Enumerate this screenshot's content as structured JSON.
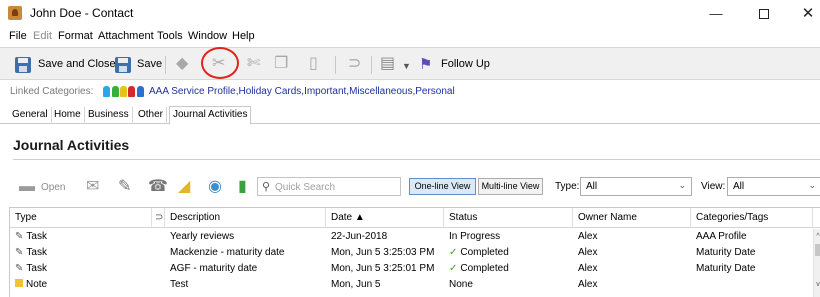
{
  "window": {
    "title": "John Doe - Contact",
    "minimize_glyph": "—",
    "close_glyph": "✕"
  },
  "menu": [
    "File",
    "Edit",
    "Format",
    "Attachment",
    "Tools",
    "Window",
    "Help"
  ],
  "menu_disabled": [
    "Edit"
  ],
  "toolbar": {
    "save_and_close": "Save and Close",
    "save": "Save",
    "follow_up": "Follow Up",
    "icons": [
      "floppy-icon",
      "eraser-icon",
      "cut-icon",
      "copy-icon",
      "paste-icon",
      "clipboard-icon",
      "attach-icon",
      "print-icon",
      "dropdown-icon",
      "follow-up-flag-icon"
    ]
  },
  "linked_categories": {
    "label": "Linked Categories:",
    "tag_colors": [
      "#2ea5e8",
      "#33b23a",
      "#e8c21c",
      "#d42a2a",
      "#2e6fd6"
    ],
    "value": "AAA Service Profile,Holiday Cards,Important,Miscellaneous,Personal"
  },
  "tabs": [
    "General",
    "Home",
    "Business",
    "Other",
    "Journal Activities"
  ],
  "active_tab": "Journal Activities",
  "section": {
    "title": "Journal Activities"
  },
  "activities": {
    "open_label": "Open",
    "search_placeholder": "Quick Search",
    "one_line_view": "One-line View",
    "multi_line_view": "Multi-line View",
    "type_label": "Type:",
    "type_value": "All",
    "view_label": "View:",
    "view_value": "All"
  },
  "grid": {
    "columns": [
      "Type",
      "",
      "Description",
      "Date ▲",
      "Status",
      "Owner Name",
      "Categories/Tags"
    ],
    "rows": [
      {
        "type": "Task",
        "description": "Yearly reviews",
        "date": "22-Jun-2018",
        "status": "In Progress",
        "status_check": false,
        "owner": "Alex",
        "category": "AAA Profile"
      },
      {
        "type": "Task",
        "description": "Mackenzie - maturity date",
        "date": "Mon, Jun 5 3:25:03 PM",
        "status": "Completed",
        "status_check": true,
        "owner": "Alex",
        "category": "Maturity Date"
      },
      {
        "type": "Task",
        "description": "AGF - maturity date",
        "date": "Mon, Jun 5 3:25:01 PM",
        "status": "Completed",
        "status_check": true,
        "owner": "Alex",
        "category": "Maturity Date"
      },
      {
        "type": "Note",
        "description": "Test",
        "date": "Mon, Jun 5",
        "status": "None",
        "status_check": false,
        "owner": "Alex",
        "category": ""
      }
    ]
  },
  "colors": {
    "annotation_circle": "#e0241b",
    "link_blue": "#1f2f9e",
    "toolbar_bg": "#f0f0f0",
    "check_green": "#3b9c1a"
  }
}
